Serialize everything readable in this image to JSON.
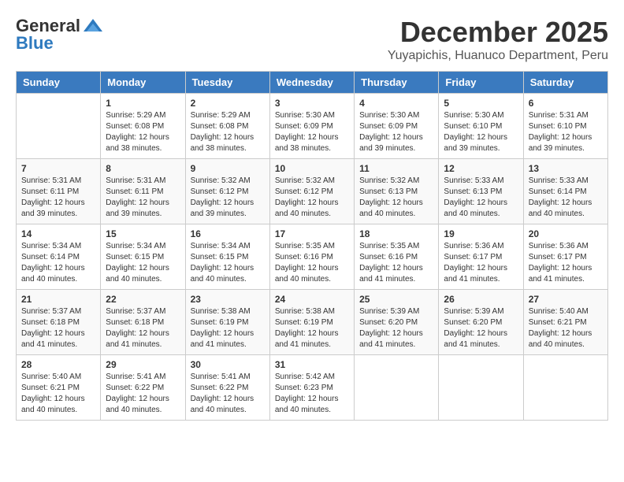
{
  "header": {
    "logo_general": "General",
    "logo_blue": "Blue",
    "month_year": "December 2025",
    "location": "Yuyapichis, Huanuco Department, Peru"
  },
  "days_of_week": [
    "Sunday",
    "Monday",
    "Tuesday",
    "Wednesday",
    "Thursday",
    "Friday",
    "Saturday"
  ],
  "weeks": [
    [
      {
        "day": "",
        "info": ""
      },
      {
        "day": "1",
        "info": "Sunrise: 5:29 AM\nSunset: 6:08 PM\nDaylight: 12 hours\nand 38 minutes."
      },
      {
        "day": "2",
        "info": "Sunrise: 5:29 AM\nSunset: 6:08 PM\nDaylight: 12 hours\nand 38 minutes."
      },
      {
        "day": "3",
        "info": "Sunrise: 5:30 AM\nSunset: 6:09 PM\nDaylight: 12 hours\nand 38 minutes."
      },
      {
        "day": "4",
        "info": "Sunrise: 5:30 AM\nSunset: 6:09 PM\nDaylight: 12 hours\nand 39 minutes."
      },
      {
        "day": "5",
        "info": "Sunrise: 5:30 AM\nSunset: 6:10 PM\nDaylight: 12 hours\nand 39 minutes."
      },
      {
        "day": "6",
        "info": "Sunrise: 5:31 AM\nSunset: 6:10 PM\nDaylight: 12 hours\nand 39 minutes."
      }
    ],
    [
      {
        "day": "7",
        "info": "Sunrise: 5:31 AM\nSunset: 6:11 PM\nDaylight: 12 hours\nand 39 minutes."
      },
      {
        "day": "8",
        "info": "Sunrise: 5:31 AM\nSunset: 6:11 PM\nDaylight: 12 hours\nand 39 minutes."
      },
      {
        "day": "9",
        "info": "Sunrise: 5:32 AM\nSunset: 6:12 PM\nDaylight: 12 hours\nand 39 minutes."
      },
      {
        "day": "10",
        "info": "Sunrise: 5:32 AM\nSunset: 6:12 PM\nDaylight: 12 hours\nand 40 minutes."
      },
      {
        "day": "11",
        "info": "Sunrise: 5:32 AM\nSunset: 6:13 PM\nDaylight: 12 hours\nand 40 minutes."
      },
      {
        "day": "12",
        "info": "Sunrise: 5:33 AM\nSunset: 6:13 PM\nDaylight: 12 hours\nand 40 minutes."
      },
      {
        "day": "13",
        "info": "Sunrise: 5:33 AM\nSunset: 6:14 PM\nDaylight: 12 hours\nand 40 minutes."
      }
    ],
    [
      {
        "day": "14",
        "info": "Sunrise: 5:34 AM\nSunset: 6:14 PM\nDaylight: 12 hours\nand 40 minutes."
      },
      {
        "day": "15",
        "info": "Sunrise: 5:34 AM\nSunset: 6:15 PM\nDaylight: 12 hours\nand 40 minutes."
      },
      {
        "day": "16",
        "info": "Sunrise: 5:34 AM\nSunset: 6:15 PM\nDaylight: 12 hours\nand 40 minutes."
      },
      {
        "day": "17",
        "info": "Sunrise: 5:35 AM\nSunset: 6:16 PM\nDaylight: 12 hours\nand 40 minutes."
      },
      {
        "day": "18",
        "info": "Sunrise: 5:35 AM\nSunset: 6:16 PM\nDaylight: 12 hours\nand 41 minutes."
      },
      {
        "day": "19",
        "info": "Sunrise: 5:36 AM\nSunset: 6:17 PM\nDaylight: 12 hours\nand 41 minutes."
      },
      {
        "day": "20",
        "info": "Sunrise: 5:36 AM\nSunset: 6:17 PM\nDaylight: 12 hours\nand 41 minutes."
      }
    ],
    [
      {
        "day": "21",
        "info": "Sunrise: 5:37 AM\nSunset: 6:18 PM\nDaylight: 12 hours\nand 41 minutes."
      },
      {
        "day": "22",
        "info": "Sunrise: 5:37 AM\nSunset: 6:18 PM\nDaylight: 12 hours\nand 41 minutes."
      },
      {
        "day": "23",
        "info": "Sunrise: 5:38 AM\nSunset: 6:19 PM\nDaylight: 12 hours\nand 41 minutes."
      },
      {
        "day": "24",
        "info": "Sunrise: 5:38 AM\nSunset: 6:19 PM\nDaylight: 12 hours\nand 41 minutes."
      },
      {
        "day": "25",
        "info": "Sunrise: 5:39 AM\nSunset: 6:20 PM\nDaylight: 12 hours\nand 41 minutes."
      },
      {
        "day": "26",
        "info": "Sunrise: 5:39 AM\nSunset: 6:20 PM\nDaylight: 12 hours\nand 41 minutes."
      },
      {
        "day": "27",
        "info": "Sunrise: 5:40 AM\nSunset: 6:21 PM\nDaylight: 12 hours\nand 40 minutes."
      }
    ],
    [
      {
        "day": "28",
        "info": "Sunrise: 5:40 AM\nSunset: 6:21 PM\nDaylight: 12 hours\nand 40 minutes."
      },
      {
        "day": "29",
        "info": "Sunrise: 5:41 AM\nSunset: 6:22 PM\nDaylight: 12 hours\nand 40 minutes."
      },
      {
        "day": "30",
        "info": "Sunrise: 5:41 AM\nSunset: 6:22 PM\nDaylight: 12 hours\nand 40 minutes."
      },
      {
        "day": "31",
        "info": "Sunrise: 5:42 AM\nSunset: 6:23 PM\nDaylight: 12 hours\nand 40 minutes."
      },
      {
        "day": "",
        "info": ""
      },
      {
        "day": "",
        "info": ""
      },
      {
        "day": "",
        "info": ""
      }
    ]
  ]
}
